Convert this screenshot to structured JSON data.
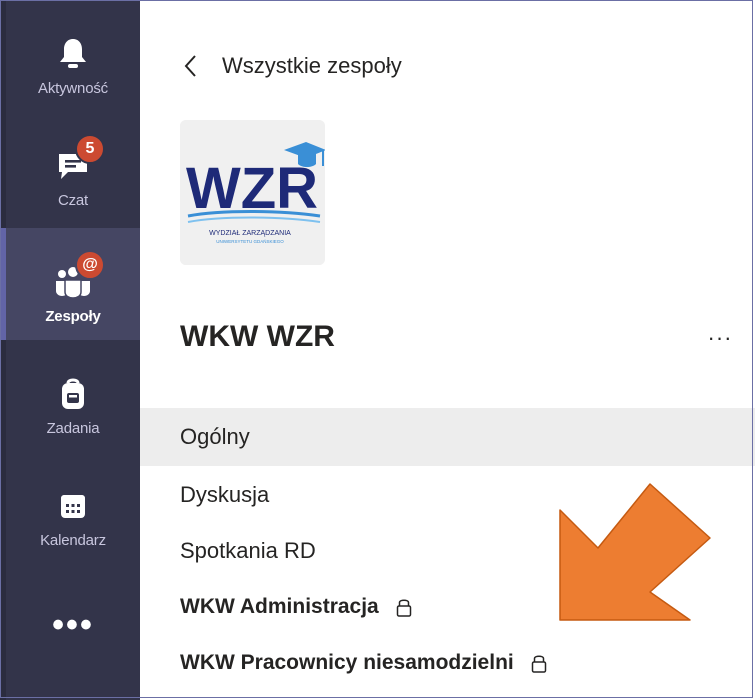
{
  "rail": {
    "items": [
      {
        "label": "Aktywność",
        "icon": "bell-icon"
      },
      {
        "label": "Czat",
        "icon": "chat-icon",
        "badge": "5"
      },
      {
        "label": "Zespoły",
        "icon": "teams-icon",
        "badge": "@"
      },
      {
        "label": "Zadania",
        "icon": "backpack-icon"
      },
      {
        "label": "Kalendarz",
        "icon": "calendar-icon"
      }
    ],
    "more_label": "•••",
    "active_index": 2
  },
  "header": {
    "back_label": "Wszystkie zespoły"
  },
  "team": {
    "name": "WKW WZR",
    "more_label": "···",
    "logo": {
      "text": "WZR",
      "subtitle": "WYDZIAŁ ZARZĄDZANIA",
      "subtitle2": "UNIWERSYTETU GDAŃSKIEGO"
    }
  },
  "channels": [
    {
      "label": "Ogólny",
      "selected": true,
      "private": false
    },
    {
      "label": "Dyskusja",
      "selected": false,
      "private": false
    },
    {
      "label": "Spotkania RD",
      "selected": false,
      "private": false
    },
    {
      "label": "WKW Administracja",
      "selected": false,
      "private": true
    },
    {
      "label": "WKW Pracownicy niesamodzielni",
      "selected": false,
      "private": true
    }
  ],
  "colors": {
    "rail_bg": "#33344a",
    "rail_active": "#454663",
    "accent": "#6264a7",
    "badge": "#cc4a31",
    "arrow": "#ed7d31",
    "logo_navy": "#1e2a78",
    "logo_blue": "#3a8fd6"
  }
}
